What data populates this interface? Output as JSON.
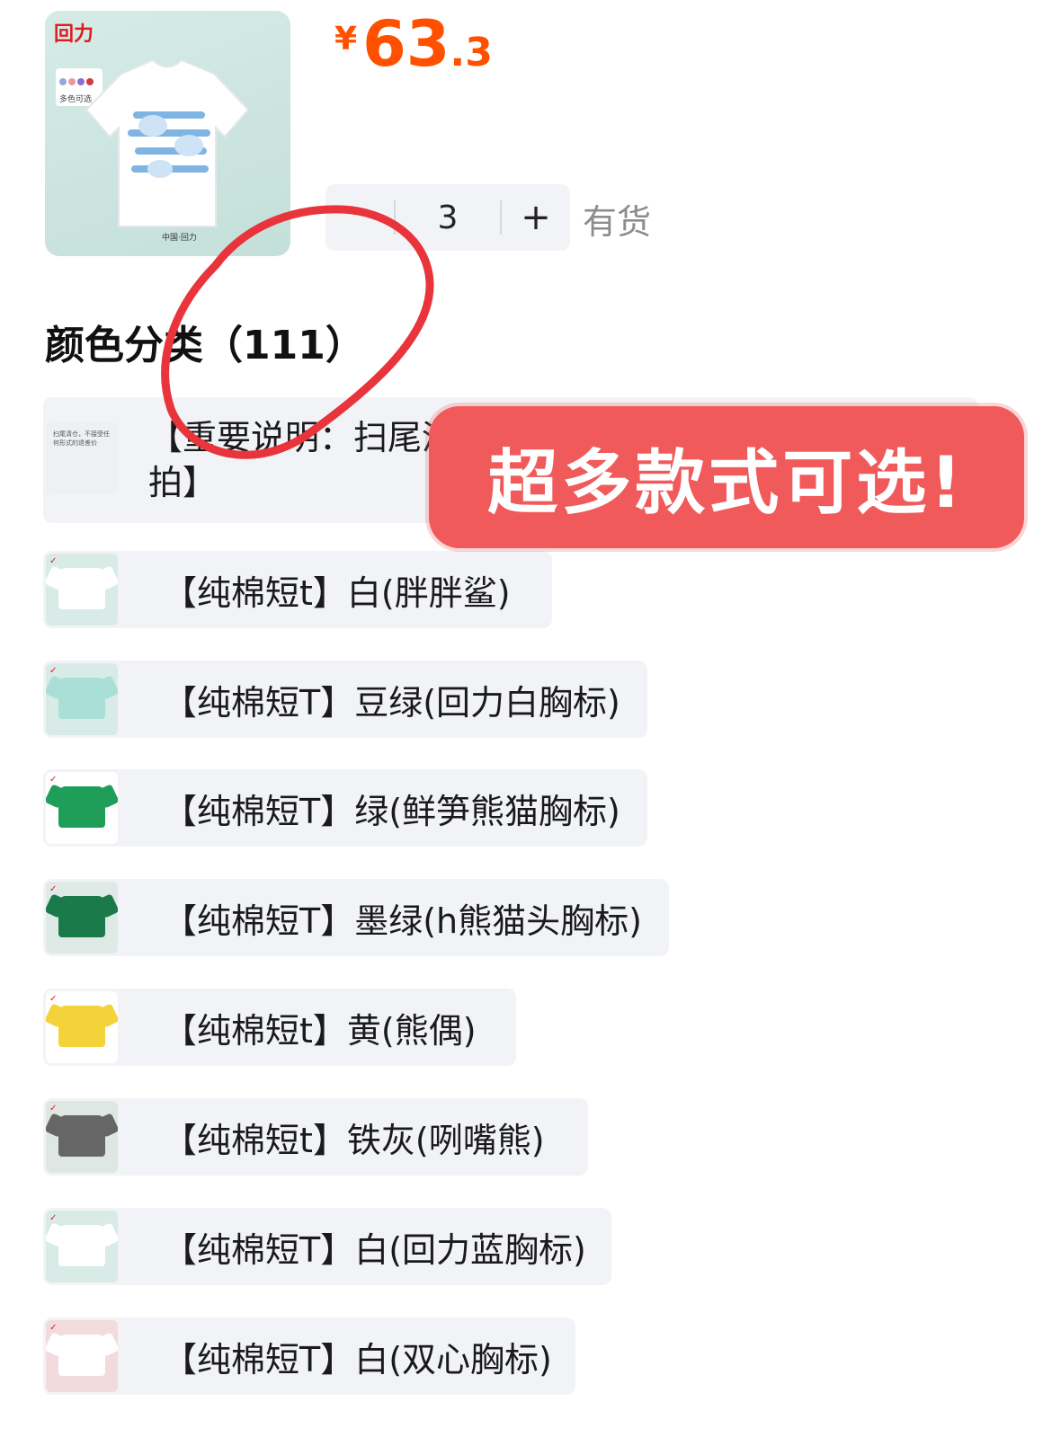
{
  "product": {
    "thumbnail_alt": "short-sleeve t-shirt thumbnail",
    "thumbnail_icon": "tshirt-image",
    "brand_logo_text": "回力",
    "swatch_colors": [
      "#9aa6d8",
      "#e59aa0",
      "#8c6fcf",
      "#d23b3b"
    ],
    "swatch_caption": "多色可选"
  },
  "price": {
    "currency": "¥",
    "integer": "63",
    "decimal": ".3",
    "color": "#ff5000"
  },
  "quantity": {
    "value": "3",
    "plus_label": "+",
    "stock_status": "有货"
  },
  "section": {
    "title": "颜色分类（111）"
  },
  "options": [
    {
      "label": "【重要说明：扫尾清仓，不接受退差价】【此项勿拍】",
      "thumb_color": "#eef1f4",
      "notice_text": "扫尾清仓，不接受任何形式的退差价"
    },
    {
      "label": "【纯棉短t】白(胖胖鲨)",
      "thumb_color": "#d8ebe6",
      "tee_color": "#ffffff"
    },
    {
      "label": "【纯棉短T】豆绿(回力白胸标)",
      "thumb_color": "#d8ebe6",
      "tee_color": "#a9dfd6"
    },
    {
      "label": "【纯棉短T】绿(鲜笋熊猫胸标)",
      "thumb_color": "#ffffff",
      "tee_color": "#1f9e5a"
    },
    {
      "label": "【纯棉短T】墨绿(h熊猫头胸标)",
      "thumb_color": "#dfeae6",
      "tee_color": "#1b7a4a"
    },
    {
      "label": "【纯棉短t】黄(熊偶)",
      "thumb_color": "#ffffff",
      "tee_color": "#f3d23a"
    },
    {
      "label": "【纯棉短t】铁灰(咧嘴熊)",
      "thumb_color": "#dfe7e4",
      "tee_color": "#666666"
    },
    {
      "label": "【纯棉短T】白(回力蓝胸标)",
      "thumb_color": "#d8ebe6",
      "tee_color": "#ffffff"
    },
    {
      "label": "【纯棉短T】白(双心胸标)",
      "thumb_color": "#f3dadd",
      "tee_color": "#ffffff"
    }
  ],
  "promo_banner": {
    "text": "超多款式可选!",
    "color": "#f15a5a"
  },
  "annotation": {
    "circle_color": "#e8343a"
  }
}
